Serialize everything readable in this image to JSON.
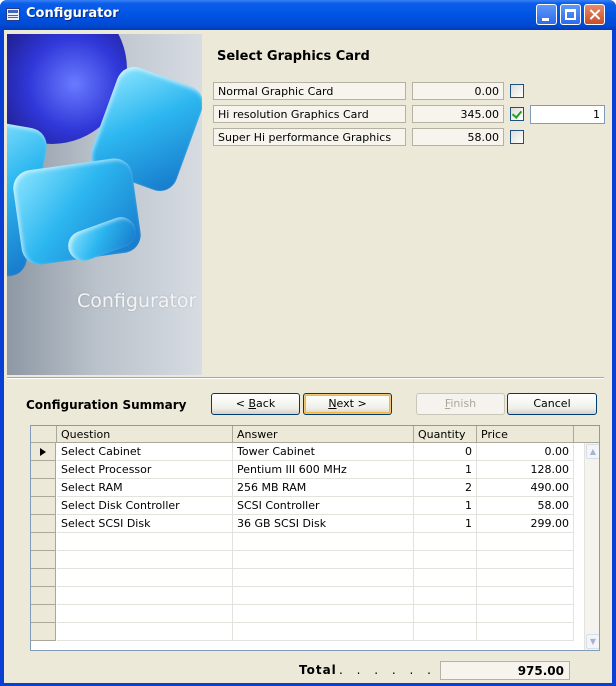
{
  "window": {
    "title": "Configurator"
  },
  "art": {
    "caption": "Configurator"
  },
  "step": {
    "title": "Select Graphics Card",
    "options": [
      {
        "label": "Normal Graphic Card",
        "price": "0.00",
        "checked": false,
        "qty": ""
      },
      {
        "label": "Hi resolution Graphics Card",
        "price": "345.00",
        "checked": true,
        "qty": "1"
      },
      {
        "label": "Super Hi performance Graphics",
        "price": "58.00",
        "checked": false,
        "qty": ""
      }
    ]
  },
  "summary": {
    "title": "Configuration Summary"
  },
  "buttons": {
    "back": "< Back",
    "next": "Next >",
    "finish": "Finish",
    "cancel": "Cancel"
  },
  "grid": {
    "columns": [
      "Question",
      "Answer",
      "Quantity",
      "Price"
    ],
    "rows": [
      {
        "question": "Select Cabinet",
        "answer": "Tower Cabinet",
        "quantity": "0",
        "price": "0.00"
      },
      {
        "question": "Select Processor",
        "answer": "Pentium III 600 MHz",
        "quantity": "1",
        "price": "128.00"
      },
      {
        "question": "Select RAM",
        "answer": "256 MB RAM",
        "quantity": "2",
        "price": "490.00"
      },
      {
        "question": "Select Disk Controller",
        "answer": "SCSI Controller",
        "quantity": "1",
        "price": "58.00"
      },
      {
        "question": "Select SCSI Disk",
        "answer": "36 GB SCSI Disk",
        "quantity": "1",
        "price": "299.00"
      }
    ],
    "empty_rows": 6
  },
  "total": {
    "label": "Total",
    "dots": ". . . . . . . .",
    "value": "975.00"
  }
}
